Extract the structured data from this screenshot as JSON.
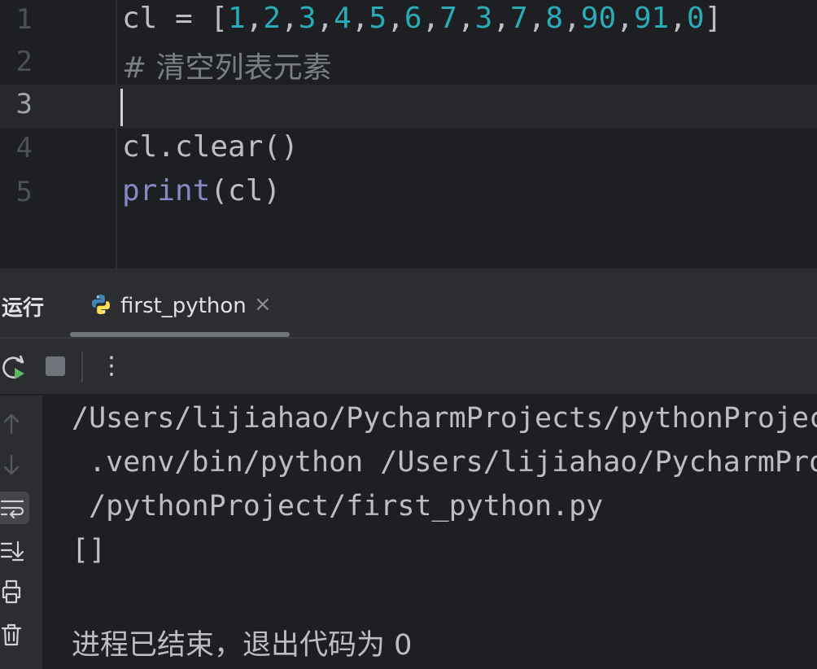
{
  "editor": {
    "lines": [
      {
        "number": "1",
        "tokens": [
          {
            "t": "cl = [",
            "c": "plain"
          },
          {
            "t": "1",
            "c": "num"
          },
          {
            "t": ",",
            "c": "plain"
          },
          {
            "t": "2",
            "c": "num"
          },
          {
            "t": ",",
            "c": "plain"
          },
          {
            "t": "3",
            "c": "num"
          },
          {
            "t": ",",
            "c": "plain"
          },
          {
            "t": "4",
            "c": "num"
          },
          {
            "t": ",",
            "c": "plain"
          },
          {
            "t": "5",
            "c": "num"
          },
          {
            "t": ",",
            "c": "plain"
          },
          {
            "t": "6",
            "c": "num"
          },
          {
            "t": ",",
            "c": "plain"
          },
          {
            "t": "7",
            "c": "num"
          },
          {
            "t": ",",
            "c": "plain"
          },
          {
            "t": "3",
            "c": "num"
          },
          {
            "t": ",",
            "c": "plain"
          },
          {
            "t": "7",
            "c": "num"
          },
          {
            "t": ",",
            "c": "plain"
          },
          {
            "t": "8",
            "c": "num"
          },
          {
            "t": ",",
            "c": "plain"
          },
          {
            "t": "90",
            "c": "num"
          },
          {
            "t": ",",
            "c": "plain"
          },
          {
            "t": "91",
            "c": "num"
          },
          {
            "t": ",",
            "c": "plain"
          },
          {
            "t": "0",
            "c": "num"
          },
          {
            "t": "]",
            "c": "plain"
          }
        ]
      },
      {
        "number": "2",
        "tokens": [
          {
            "t": "# 清空列表元素",
            "c": "cmt"
          }
        ]
      },
      {
        "number": "3",
        "tokens": [],
        "current": true
      },
      {
        "number": "4",
        "tokens": [
          {
            "t": "cl.clear()",
            "c": "plain"
          }
        ]
      },
      {
        "number": "5",
        "tokens": [
          {
            "t": "print",
            "c": "kw"
          },
          {
            "t": "(cl)",
            "c": "plain"
          }
        ]
      }
    ]
  },
  "run_panel": {
    "title": "运行",
    "tab_label": "first_python",
    "tab_close": "×",
    "more_glyph": "⋮"
  },
  "console": {
    "lines": [
      "/Users/lijiahao/PycharmProjects/pythonProject/",
      " .venv/bin/python /Users/lijiahao/PycharmProjects",
      " /pythonProject/first_python.py",
      "[]",
      "",
      "进程已结束，退出代码为 0"
    ]
  },
  "icons": {
    "rerun": "rerun-icon",
    "stop": "stop-icon",
    "scroll_up": "arrow-up-icon",
    "scroll_down": "arrow-down-icon",
    "soft_wrap": "soft-wrap-icon",
    "scroll_to_end": "scroll-to-end-icon",
    "print": "print-icon",
    "clear": "trash-icon",
    "python": "python-icon"
  },
  "colors": {
    "number": "#2aacb8",
    "keyword": "#8888c6",
    "comment": "#7a7e85",
    "text": "#bcbec4",
    "run_green": "#5fb865"
  }
}
